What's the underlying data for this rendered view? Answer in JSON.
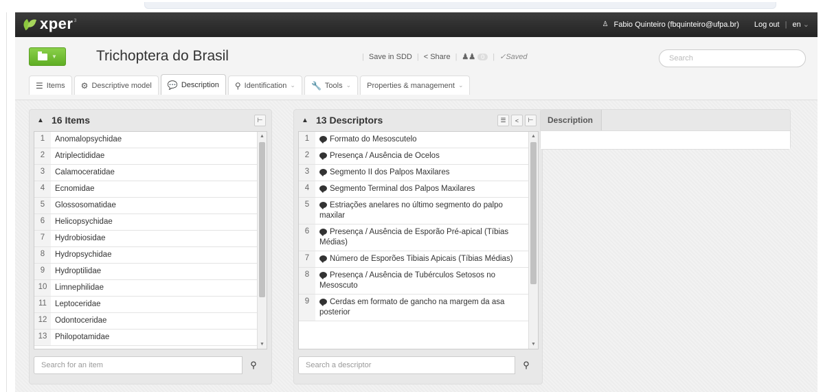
{
  "navbar": {
    "logo": "xper",
    "logo_sup": "3",
    "user": "Fabio Quinteiro (fbquinteiro@ufpa.br)",
    "logout": "Log out",
    "lang": "en"
  },
  "header": {
    "title": "Trichoptera do Brasil",
    "save_sdd": "Save in SDD",
    "share": "Share",
    "users_count": "0",
    "saved": "Saved",
    "search_placeholder": "Search"
  },
  "tabs": [
    {
      "label": "Items",
      "icon": "list-icon"
    },
    {
      "label": "Descriptive model",
      "icon": "gears-icon"
    },
    {
      "label": "Description",
      "icon": "speech-icon"
    },
    {
      "label": "Identification",
      "icon": "magnifier-icon"
    },
    {
      "label": "Tools",
      "icon": "wrench-icon"
    },
    {
      "label": "Properties & management",
      "icon": ""
    }
  ],
  "items_panel": {
    "title": "16 Items",
    "search_placeholder": "Search for an item",
    "rows": [
      {
        "num": "1",
        "label": "Anomalopsychidae"
      },
      {
        "num": "2",
        "label": "Atriplectididae"
      },
      {
        "num": "3",
        "label": "Calamoceratidae"
      },
      {
        "num": "4",
        "label": "Ecnomidae"
      },
      {
        "num": "5",
        "label": "Glossosomatidae"
      },
      {
        "num": "6",
        "label": "Helicopsychidae"
      },
      {
        "num": "7",
        "label": "Hydrobiosidae"
      },
      {
        "num": "8",
        "label": "Hydropsychidae"
      },
      {
        "num": "9",
        "label": "Hydroptilidae"
      },
      {
        "num": "10",
        "label": "Limnephilidae"
      },
      {
        "num": "11",
        "label": "Leptoceridae"
      },
      {
        "num": "12",
        "label": "Odontoceridae"
      },
      {
        "num": "13",
        "label": "Philopotamidae"
      }
    ]
  },
  "descriptors_panel": {
    "title": "13 Descriptors",
    "search_placeholder": "Search a descriptor",
    "rows": [
      {
        "num": "1",
        "label": "Formato do Mesoscutelo"
      },
      {
        "num": "2",
        "label": "Presença / Ausência de Ocelos"
      },
      {
        "num": "3",
        "label": "Segmento II dos Palpos Maxilares"
      },
      {
        "num": "4",
        "label": "Segmento Terminal dos Palpos Maxilares"
      },
      {
        "num": "5",
        "label": "Estriações anelares no último segmento do palpo maxilar"
      },
      {
        "num": "6",
        "label": "Presença / Ausência de Esporão Pré-apical (Tíbias Médias)"
      },
      {
        "num": "7",
        "label": "Número de Esporões Tibiais Apicais (Tíbias Médias)"
      },
      {
        "num": "8",
        "label": "Presença / Ausência de Tubérculos Setosos no Mesoscuto"
      },
      {
        "num": "9",
        "label": "Cerdas em formato de gancho na margem da asa posterior"
      }
    ]
  },
  "description_panel": {
    "tab": "Description"
  }
}
